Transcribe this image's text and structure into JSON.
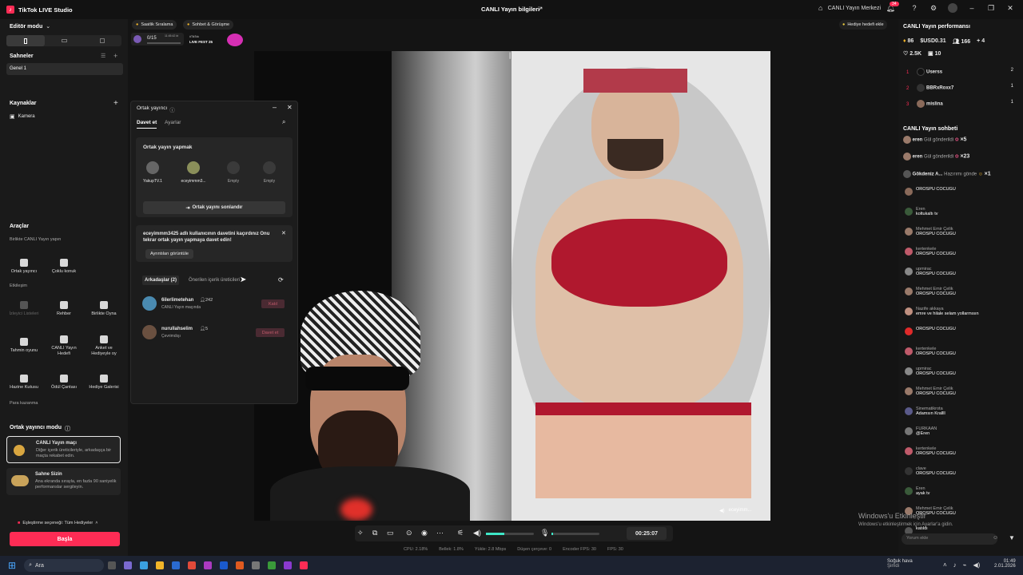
{
  "titlebar": {
    "app_name": "TikTok LIVE Studio",
    "center_title": "CANLI Yayın bilgileri",
    "live_center": "CANLI Yayın Merkezi",
    "notif_count": "34"
  },
  "topbar": {
    "chip1": "Saatlik Sıralama",
    "chip2": "Sohbet & Görüşme",
    "progress": "0/15",
    "progress_time": "11:45:42 kt",
    "event": "LIVE FEST 25",
    "event_small": "#TikTok",
    "gift_goal": "Hediye hedefi ekle"
  },
  "left": {
    "editor_mode": "Editör modu",
    "scenes_title": "Sahneler",
    "scene1": "Genel 1",
    "sources_title": "Kaynaklar",
    "source1": "Kamera",
    "tools_title": "Araçlar",
    "group1": "Birlikte CANLI Yayın yapın",
    "tile_cohost": "Ortak yayıncı",
    "tile_multi": "Çoklu konuk",
    "group2": "Etkileşim",
    "tile_creator_lists": "İzleyici Listeleri",
    "tile_guide": "Rehber",
    "tile_play": "Birlikte Oyna",
    "tile_guess": "Tahmin oyunu",
    "tile_live_goal": "CANLI Yayın Hedefi",
    "tile_poll": "Anket ve Hediyeyle oy",
    "tile_treasure": "Hazine Kutusu",
    "tile_reward_bag": "Ödül Çantası",
    "tile_gift_gallery": "Hediye Galerisi",
    "group3": "Para kazanma",
    "cohost_mode": "Ortak yayıncı modu",
    "match_title": "CANLI Yayın maçı",
    "match_desc": "Diğer içerik üreticileriyle, arkadaşça bir maçta rekabet edin.",
    "stage_title": "Sahne Sizin",
    "stage_desc": "Ana ekranda sırayla, en fazla 90 saniyelik performanslar sergileyin.",
    "pairing": "Eşleştirme seçeneği: Tüm Hediyeler",
    "start": "Başla"
  },
  "panel": {
    "title": "Ortak yayıncı",
    "tab_invite": "Davet et",
    "tab_settings": "Ayarlar",
    "section": "Ortak yayın yapmak",
    "slots": [
      {
        "name": "YakupTV.1",
        "color": "#3a3a3a"
      },
      {
        "name": "eceyimmm3...",
        "color": "#8a8f5a"
      },
      {
        "name": "Empty",
        "color": "#3a3a3a"
      },
      {
        "name": "Empty",
        "color": "#3a3a3a"
      }
    ],
    "end_button": "Ortak yayını sonlandır",
    "notice": "eceyimmm3425 adlı kullanıcının davetini kaçırdınız Onu tekrar ortak yayın yapmaya davet edin!",
    "details": "Ayrıntıları görüntüle",
    "friends_tab": "Arkadaşlar (2)",
    "suggested_tab": "Önerilen içerik üreticileri",
    "friends": [
      {
        "name": "6ilerlimetehan",
        "count": "242",
        "status": "CANLI Yayın maçında",
        "action": "Katıl",
        "color": "#4a8ab0"
      },
      {
        "name": "nurullahselim",
        "count": "5",
        "status": "Çevrimdışı",
        "action": "Davet et",
        "color": "#6a5040"
      }
    ]
  },
  "video": {
    "right_user": "eceyimm..."
  },
  "right": {
    "perf_title": "CANLI Yayın performansı",
    "stat_coins": "86",
    "stat_usd": "USD0.31",
    "stat_viewers": "166",
    "stat_follow": "4",
    "stat_likes": "2.5K",
    "stat_shares": "10",
    "ranking": [
      {
        "rank": "1",
        "name": "Userss",
        "value": "2"
      },
      {
        "rank": "2",
        "name": "BBRxRoxx7",
        "value": "1"
      },
      {
        "rank": "3",
        "name": "mislina",
        "value": "1"
      }
    ],
    "chat_title": "CANLI Yayın sohbeti",
    "gifts": [
      {
        "name": "eren",
        "msg": "Gül gönderildi",
        "count": "×5"
      },
      {
        "name": "eren",
        "msg": "Gül gönderildi",
        "count": "×23"
      },
      {
        "name": "Gökdeniz A...",
        "msg": "Hazırımı gönde",
        "count": "×1"
      }
    ],
    "chat": [
      {
        "name": "",
        "msg": "OROSPU COCUGU"
      },
      {
        "name": "Eren",
        "msg": "koltukaltı tv"
      },
      {
        "name": "Mehmet Emir Çelik",
        "msg": "OROSPU COCUGU"
      },
      {
        "name": "kertenkele",
        "msg": "OROSPU COCUGU"
      },
      {
        "name": "upmirac",
        "msg": "OROSPU COCUGU"
      },
      {
        "name": "Mehmet Emir Çelik",
        "msg": "OROSPU COCUGU"
      },
      {
        "name": "Nazife akkaya",
        "msg": "emre ve hilale selam yollarmısın"
      },
      {
        "name": "",
        "msg": "OROSPU COCUGU"
      },
      {
        "name": "kertenkele",
        "msg": "OROSPU COCUGU"
      },
      {
        "name": "upmirac",
        "msg": "OROSPU COCUGU"
      },
      {
        "name": "Mehmet Emir Çelik",
        "msg": "OROSPU COCUGU"
      },
      {
        "name": "Sinematikrota",
        "msg": "Adamsın Krallll"
      },
      {
        "name": "FURKAAN",
        "msg": "@Eren"
      },
      {
        "name": "kertenkele",
        "msg": "OROSPU COCUGU"
      },
      {
        "name": "clave",
        "msg": "OROSPU COCUGU"
      },
      {
        "name": "Eren",
        "msg": "ayak tv"
      },
      {
        "name": "Mehmet Emir Çelik",
        "msg": "OROSPU COCUGU"
      },
      {
        "name": "",
        "msg": "katıldı"
      }
    ],
    "comment_placeholder": "Yorum ekle"
  },
  "controls": {
    "timer": "00:25:07"
  },
  "status": {
    "cpu": "CPU: 2.18%",
    "mem": "Bellek: 1.8%",
    "upload": "Yükle: 2.8 Mbps",
    "drop": "Düşen çerçeve: 0",
    "encoder": "Encoder FPS: 30",
    "fps": "FPS: 30"
  },
  "watermark": {
    "line1": "Windows'u Etkinleştir",
    "line2": "Windows'u etkinleştirmek için Ayarlar'a gidin."
  },
  "taskbar": {
    "search": "Ara",
    "weather": "Soğuk hava",
    "weather_sub": "Şimdi",
    "time": "01:49",
    "date": "2.01.2026"
  }
}
